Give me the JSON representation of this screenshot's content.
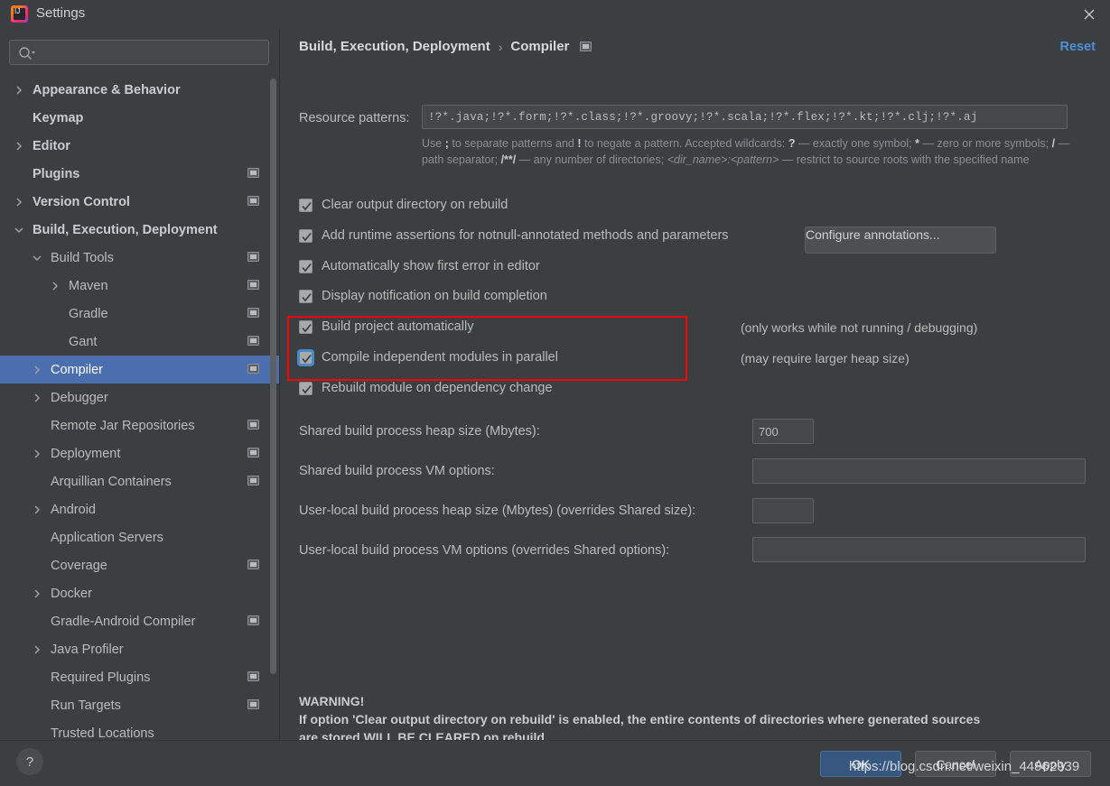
{
  "window": {
    "title": "Settings",
    "logo_icon": "intellij-idea-logo",
    "close_icon": "close-icon"
  },
  "sidebar": {
    "search": {
      "placeholder": "",
      "value": "",
      "icon": "search-icon"
    },
    "items": [
      {
        "label": "Appearance & Behavior",
        "indent": 0,
        "arrow": "chevron-right",
        "badge": false,
        "top": true,
        "selected": false
      },
      {
        "label": "Keymap",
        "indent": 0,
        "arrow": "",
        "badge": false,
        "top": true,
        "selected": false
      },
      {
        "label": "Editor",
        "indent": 0,
        "arrow": "chevron-right",
        "badge": false,
        "top": true,
        "selected": false
      },
      {
        "label": "Plugins",
        "indent": 0,
        "arrow": "",
        "badge": true,
        "top": true,
        "selected": false
      },
      {
        "label": "Version Control",
        "indent": 0,
        "arrow": "chevron-right",
        "badge": true,
        "top": true,
        "selected": false
      },
      {
        "label": "Build, Execution, Deployment",
        "indent": 0,
        "arrow": "chevron-down",
        "badge": false,
        "top": true,
        "selected": false
      },
      {
        "label": "Build Tools",
        "indent": 1,
        "arrow": "chevron-down",
        "badge": true,
        "top": false,
        "selected": false
      },
      {
        "label": "Maven",
        "indent": 2,
        "arrow": "chevron-right",
        "badge": true,
        "top": false,
        "selected": false
      },
      {
        "label": "Gradle",
        "indent": 2,
        "arrow": "",
        "badge": true,
        "top": false,
        "selected": false
      },
      {
        "label": "Gant",
        "indent": 2,
        "arrow": "",
        "badge": true,
        "top": false,
        "selected": false
      },
      {
        "label": "Compiler",
        "indent": 1,
        "arrow": "chevron-right",
        "badge": true,
        "top": false,
        "selected": true
      },
      {
        "label": "Debugger",
        "indent": 1,
        "arrow": "chevron-right",
        "badge": false,
        "top": false,
        "selected": false
      },
      {
        "label": "Remote Jar Repositories",
        "indent": 1,
        "arrow": "",
        "badge": true,
        "top": false,
        "selected": false
      },
      {
        "label": "Deployment",
        "indent": 1,
        "arrow": "chevron-right",
        "badge": true,
        "top": false,
        "selected": false
      },
      {
        "label": "Arquillian Containers",
        "indent": 1,
        "arrow": "",
        "badge": true,
        "top": false,
        "selected": false
      },
      {
        "label": "Android",
        "indent": 1,
        "arrow": "chevron-right",
        "badge": false,
        "top": false,
        "selected": false
      },
      {
        "label": "Application Servers",
        "indent": 1,
        "arrow": "",
        "badge": false,
        "top": false,
        "selected": false
      },
      {
        "label": "Coverage",
        "indent": 1,
        "arrow": "",
        "badge": true,
        "top": false,
        "selected": false
      },
      {
        "label": "Docker",
        "indent": 1,
        "arrow": "chevron-right",
        "badge": false,
        "top": false,
        "selected": false
      },
      {
        "label": "Gradle-Android Compiler",
        "indent": 1,
        "arrow": "",
        "badge": true,
        "top": false,
        "selected": false
      },
      {
        "label": "Java Profiler",
        "indent": 1,
        "arrow": "chevron-right",
        "badge": false,
        "top": false,
        "selected": false
      },
      {
        "label": "Required Plugins",
        "indent": 1,
        "arrow": "",
        "badge": true,
        "top": false,
        "selected": false
      },
      {
        "label": "Run Targets",
        "indent": 1,
        "arrow": "",
        "badge": true,
        "top": false,
        "selected": false
      },
      {
        "label": "Trusted Locations",
        "indent": 1,
        "arrow": "",
        "badge": false,
        "top": false,
        "selected": false
      }
    ]
  },
  "main": {
    "breadcrumb": {
      "parent": "Build, Execution, Deployment",
      "separator": "›",
      "current": "Compiler",
      "badge_icon": "project-scope-icon"
    },
    "reset_label": "Reset",
    "resource_patterns": {
      "label": "Resource patterns:",
      "value": "!?*.java;!?*.form;!?*.class;!?*.groovy;!?*.scala;!?*.flex;!?*.kt;!?*.clj;!?*.aj",
      "expand_icon": "expand-icon"
    },
    "hint_line1_a": "Use ",
    "hint_semicolon": ";",
    "hint_line1_b": " to separate patterns and ",
    "hint_bang": "!",
    "hint_line1_c": " to negate a pattern. Accepted wildcards: ",
    "hint_q": "?",
    "hint_line1_d": " — exactly one symbol; ",
    "hint_star": "*",
    "hint_line1_e": " — zero or more symbols; ",
    "hint_slash": "/",
    "hint_line1_f": " — path separator; ",
    "hint_globstar": "/**/",
    "hint_line1_g": " — any number of directories; ",
    "hint_dirname": "<dir_name>:<pattern>",
    "hint_line1_h": " — restrict to source roots with the specified name",
    "checkboxes": [
      {
        "label": "Clear output directory on rebuild",
        "checked": true,
        "focused": false
      },
      {
        "label": "Add runtime assertions for notnull-annotated methods and parameters",
        "checked": true,
        "focused": false
      },
      {
        "label": "Automatically show first error in editor",
        "checked": true,
        "focused": false
      },
      {
        "label": "Display notification on build completion",
        "checked": true,
        "focused": false
      },
      {
        "label": "Build project automatically",
        "checked": true,
        "focused": false
      },
      {
        "label": "Compile independent modules in parallel",
        "checked": true,
        "focused": true
      },
      {
        "label": "Rebuild module on dependency change",
        "checked": true,
        "focused": false
      }
    ],
    "configure_annotations_label": "Configure annotations...",
    "note_build_auto": "(only works while not running / debugging)",
    "note_parallel": "(may require larger heap size)",
    "fields": [
      {
        "label": "Shared build process heap size (Mbytes):",
        "value": "700",
        "placeholder": ""
      },
      {
        "label": "Shared build process VM options:",
        "value": "",
        "placeholder": ""
      },
      {
        "label": "User-local build process heap size (Mbytes) (overrides Shared size):",
        "value": "",
        "placeholder": ""
      },
      {
        "label": "User-local build process VM options (overrides Shared options):",
        "value": "",
        "placeholder": ""
      }
    ],
    "warning_title": "WARNING!",
    "warning_line1": "If option 'Clear output directory on rebuild' is enabled, the entire contents of directories where generated sources",
    "warning_line2": "are stored WILL BE CLEARED on rebuild.",
    "highlight_color": "#ff0000"
  },
  "footer": {
    "help_label": "?",
    "ok_label": "OK",
    "cancel_label": "Cancel",
    "apply_label": "Apply"
  },
  "watermark": {
    "text": "https://blog.csdn.net/weixin_44962939"
  }
}
